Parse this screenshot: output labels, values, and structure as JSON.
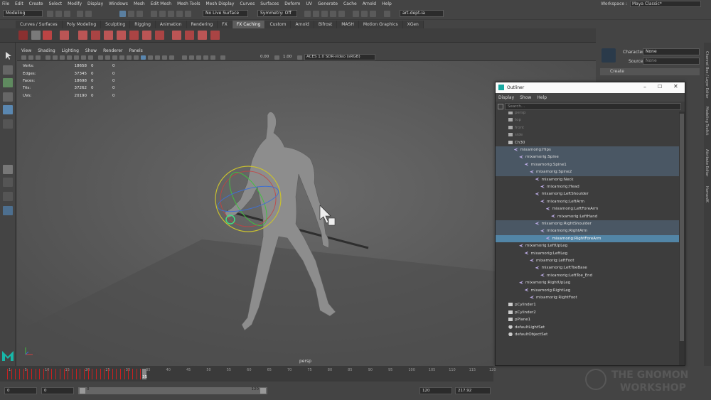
{
  "menubar": {
    "items": [
      "File",
      "Edit",
      "Create",
      "Select",
      "Modify",
      "Display",
      "Windows",
      "Mesh",
      "Edit Mesh",
      "Mesh Tools",
      "Mesh Display",
      "Curves",
      "Surfaces",
      "Deform",
      "UV",
      "Generate",
      "Cache",
      "Arnold",
      "Help"
    ],
    "workspace_label": "Workspace :",
    "workspace_value": "Maya Classic*"
  },
  "statusline": {
    "mode": "Modeling",
    "live_surface": "No Live Surface",
    "symmetry": "Symmetry: Off",
    "project": "art-dept-ia"
  },
  "shelf_tabs": [
    "Curves / Surfaces",
    "Poly Modeling",
    "Sculpting",
    "Rigging",
    "Animation",
    "Rendering",
    "FX",
    "FX Caching",
    "Custom",
    "Arnold",
    "Bifrost",
    "MASH",
    "Motion Graphics",
    "XGen"
  ],
  "shelf_active_tab": "FX Caching",
  "viewport": {
    "menu": [
      "View",
      "Shading",
      "Lighting",
      "Show",
      "Renderer",
      "Panels"
    ],
    "exposure": "0.00",
    "gamma": "1.00",
    "color_space": "ACES 1.0 SDR-video (sRGB)",
    "camera": "persp",
    "hud": [
      {
        "label": "Verts:",
        "v1": "18658",
        "v2": "0",
        "v3": "0"
      },
      {
        "label": "Edges:",
        "v1": "37345",
        "v2": "0",
        "v3": "0"
      },
      {
        "label": "Faces:",
        "v1": "18698",
        "v2": "0",
        "v3": "0"
      },
      {
        "label": "Tris:",
        "v1": "37262",
        "v2": "0",
        "v3": "0"
      },
      {
        "label": "UVs:",
        "v1": "20190",
        "v2": "0",
        "v3": "0"
      }
    ]
  },
  "rightpanel": {
    "character_label": "Character:",
    "character_value": "None",
    "source_label": "Source:",
    "source_value": "None",
    "create_label": "Create",
    "side_tabs": [
      "Channel Box / Layer Editor",
      "Modeling Toolkit",
      "Attribute Editor",
      "HumanIK"
    ]
  },
  "outliner": {
    "title": "Outliner",
    "menu": [
      "Display",
      "Show",
      "Help"
    ],
    "search_placeholder": "Search...",
    "rows": [
      {
        "label": "persp",
        "indent": 0,
        "icon": "camera",
        "state": "dim"
      },
      {
        "label": "top",
        "indent": 0,
        "icon": "camera",
        "state": "dim"
      },
      {
        "label": "front",
        "indent": 0,
        "icon": "camera",
        "state": "dim"
      },
      {
        "label": "side",
        "indent": 0,
        "icon": "camera",
        "state": "dim"
      },
      {
        "label": "Ch30",
        "indent": 0,
        "icon": "transform",
        "state": ""
      },
      {
        "label": "mixamorig:Hips",
        "indent": 1,
        "icon": "joint",
        "state": "hl"
      },
      {
        "label": "mixamorig:Spine",
        "indent": 2,
        "icon": "joint",
        "state": "hl"
      },
      {
        "label": "mixamorig:Spine1",
        "indent": 3,
        "icon": "joint",
        "state": "hl"
      },
      {
        "label": "mixamorig:Spine2",
        "indent": 4,
        "icon": "joint",
        "state": "hl"
      },
      {
        "label": "mixamorig:Neck",
        "indent": 5,
        "icon": "joint",
        "state": ""
      },
      {
        "label": "mixamorig:Head",
        "indent": 6,
        "icon": "joint",
        "state": ""
      },
      {
        "label": "mixamorig:LeftShoulder",
        "indent": 5,
        "icon": "joint",
        "state": ""
      },
      {
        "label": "mixamorig:LeftArm",
        "indent": 6,
        "icon": "joint",
        "state": ""
      },
      {
        "label": "mixamorig:LeftForeArm",
        "indent": 7,
        "icon": "joint",
        "state": ""
      },
      {
        "label": "mixamorig:LeftHand",
        "indent": 8,
        "icon": "joint",
        "state": ""
      },
      {
        "label": "mixamorig:RightShoulder",
        "indent": 5,
        "icon": "joint",
        "state": "hl"
      },
      {
        "label": "mixamorig:RightArm",
        "indent": 6,
        "icon": "joint",
        "state": "hl"
      },
      {
        "label": "mixamorig:RightForeArm",
        "indent": 7,
        "icon": "joint",
        "state": "sel"
      },
      {
        "label": "mixamorig:LeftUpLeg",
        "indent": 2,
        "icon": "joint",
        "state": ""
      },
      {
        "label": "mixamorig:LeftLeg",
        "indent": 3,
        "icon": "joint",
        "state": ""
      },
      {
        "label": "mixamorig:LeftFoot",
        "indent": 4,
        "icon": "joint",
        "state": ""
      },
      {
        "label": "mixamorig:LeftToeBase",
        "indent": 5,
        "icon": "joint",
        "state": ""
      },
      {
        "label": "mixamorig:LeftToe_End",
        "indent": 6,
        "icon": "joint",
        "state": ""
      },
      {
        "label": "mixamorig:RightUpLeg",
        "indent": 2,
        "icon": "joint",
        "state": ""
      },
      {
        "label": "mixamorig:RightLeg",
        "indent": 3,
        "icon": "joint",
        "state": ""
      },
      {
        "label": "mixamorig:RightFoot",
        "indent": 4,
        "icon": "joint",
        "state": ""
      },
      {
        "label": "pCylinder1",
        "indent": 0,
        "icon": "mesh",
        "state": ""
      },
      {
        "label": "pCylinder2",
        "indent": 0,
        "icon": "mesh",
        "state": ""
      },
      {
        "label": "pPlane1",
        "indent": 0,
        "icon": "mesh",
        "state": ""
      },
      {
        "label": "defaultLightSet",
        "indent": 0,
        "icon": "set",
        "state": ""
      },
      {
        "label": "defaultObjectSet",
        "indent": 0,
        "icon": "set",
        "state": ""
      }
    ]
  },
  "timeline": {
    "labels": [
      "1",
      "5",
      "10",
      "15",
      "20",
      "25",
      "30",
      "35",
      "40",
      "45",
      "50",
      "55",
      "60",
      "65",
      "70",
      "75",
      "80",
      "85",
      "90",
      "95",
      "100",
      "105",
      "110",
      "115",
      "120"
    ],
    "current_frame": "35"
  },
  "range": {
    "start": "0",
    "anim_start": "0",
    "range_start": "0",
    "range_end": "120",
    "anim_end": "120",
    "end": "217.92"
  },
  "watermark": {
    "line1": "THE GNOMON",
    "line2": "WORKSHOP"
  },
  "colors": {
    "accent": "#5285a6",
    "highlight_rows": "#4a5764",
    "keyframe": "#cc2020",
    "maya_logo": "#18b7a8"
  }
}
